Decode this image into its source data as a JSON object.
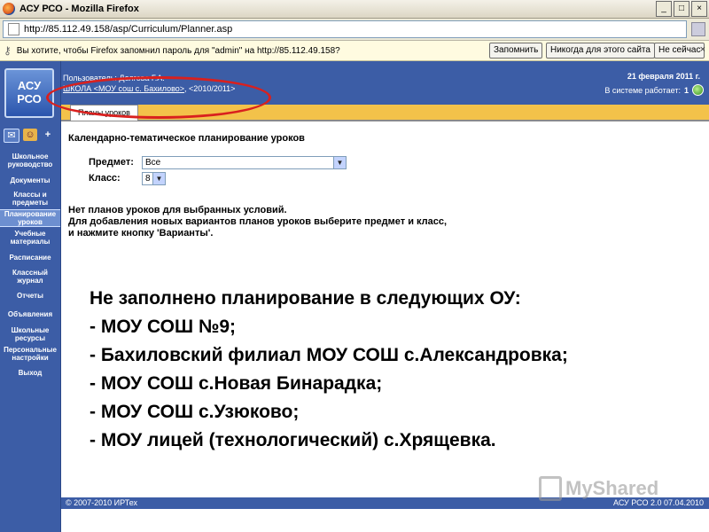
{
  "window": {
    "title": "АСУ РСО - Mozilla Firefox",
    "controls": [
      "_",
      "□",
      "×"
    ]
  },
  "address_bar": {
    "url": "http://85.112.49.158/asp/Curriculum/Planner.asp"
  },
  "notification": {
    "message": "Вы хотите, чтобы Firefox запомнил пароль для \"admin\" на http://85.112.49.158?",
    "buttons": [
      "Запомнить",
      "Никогда для этого сайта",
      "Не сейчас"
    ],
    "close": "×"
  },
  "sidebar": {
    "logo_line1": "АСУ",
    "logo_line2": "РСО",
    "items": [
      "Школьное руководство",
      "Документы",
      "Классы и предметы",
      "Планирование уроков",
      "Учебные материалы",
      "Расписание",
      "Классный журнал",
      "Отчеты",
      "Объявления",
      "Школьные ресурсы",
      "Персональные настройки",
      "Выход"
    ],
    "active_index": 3,
    "icons": [
      "mail-icon",
      "people-icon",
      "plus-icon"
    ]
  },
  "header": {
    "user": "Пользователь: Долгова Г.А.",
    "breadcrumb_link": "ШКОЛА <МОУ сош с. Бахилово>",
    "breadcrumb_rest": ", <2010/2011>",
    "date": "21 февраля 2011 г.",
    "online_label": "В системе работает:",
    "online_count": "1"
  },
  "tabs": [
    "Планы уроков"
  ],
  "panel": {
    "title": "Календарно-тематическое планирование уроков",
    "subject_label": "Предмет:",
    "subject_value": "Все",
    "class_label": "Класс:",
    "class_value": "8"
  },
  "messages": {
    "line1": "Нет планов уроков для выбранных условий.",
    "line2": "Для добавления новых вариантов планов уроков выберите предмет и класс,",
    "line3": "и нажмите кнопку 'Варианты'."
  },
  "overlay": {
    "heading": "Не заполнено планирование в следующих ОУ:",
    "items": [
      "- МОУ СОШ №9;",
      "- Бахиловский филиал МОУ СОШ с.Александровка;",
      "- МОУ СОШ с.Новая Бинарадка;",
      "- МОУ СОШ с.Узюково;",
      "- МОУ лицей (технологический) с.Хрящевка."
    ]
  },
  "footer": {
    "left": "© 2007-2010 ИРТех",
    "right": "АСУ РСО 2.0  07.04.2010"
  },
  "watermark": {
    "text": "MyShared"
  },
  "colors": {
    "sidebar_blue": "#3c5da6",
    "tab_strip": "#f3c24a",
    "annotation_red": "#d9201e"
  }
}
